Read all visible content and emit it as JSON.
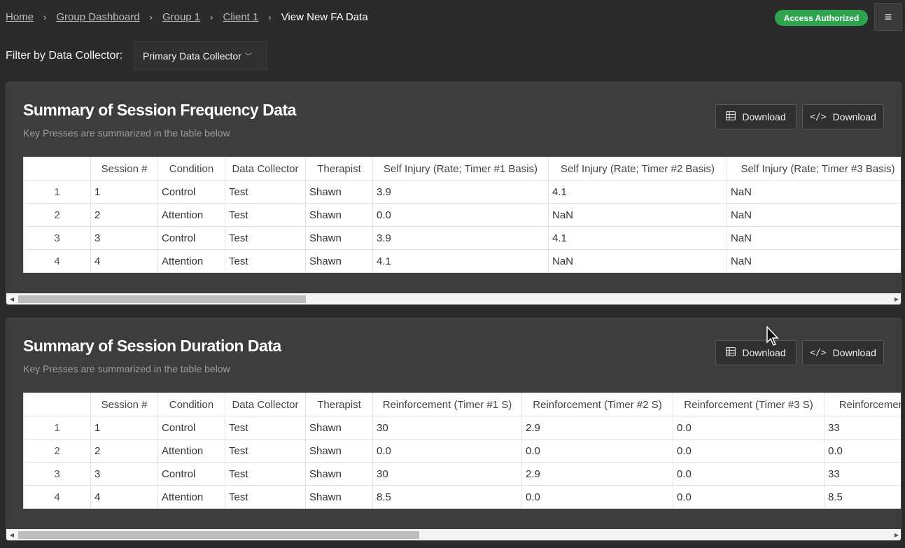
{
  "breadcrumb": {
    "items": [
      "Home",
      "Group Dashboard",
      "Group 1",
      "Client 1"
    ],
    "current": "View New FA Data"
  },
  "status_badge": "Access Authorized",
  "filter": {
    "label": "Filter by Data Collector:",
    "selected": "Primary Data Collector"
  },
  "frequency_panel": {
    "title": "Summary of Session Frequency Data",
    "subtitle": "Key Presses are summarized in the table below",
    "download_table_label": "Download",
    "download_code_label": "Download",
    "columns": [
      "",
      "Session #",
      "Condition",
      "Data Collector",
      "Therapist",
      "Self Injury (Rate; Timer #1 Basis)",
      "Self Injury (Rate; Timer #2 Basis)",
      "Self Injury (Rate; Timer #3 Basis)"
    ],
    "rows": [
      [
        "1",
        "1",
        "Control",
        "Test",
        "Shawn",
        "3.9",
        "4.1",
        "NaN"
      ],
      [
        "2",
        "2",
        "Attention",
        "Test",
        "Shawn",
        "0.0",
        "NaN",
        "NaN"
      ],
      [
        "3",
        "3",
        "Control",
        "Test",
        "Shawn",
        "3.9",
        "4.1",
        "NaN"
      ],
      [
        "4",
        "4",
        "Attention",
        "Test",
        "Shawn",
        "4.1",
        "NaN",
        "NaN"
      ]
    ],
    "scroll_fraction": 0.33
  },
  "duration_panel": {
    "title": "Summary of Session Duration Data",
    "subtitle": "Key Presses are summarized in the table below",
    "download_table_label": "Download",
    "download_code_label": "Download",
    "columns": [
      "",
      "Session #",
      "Condition",
      "Data Collector",
      "Therapist",
      "Reinforcement (Timer #1 S)",
      "Reinforcement (Timer #2 S)",
      "Reinforcement (Timer #3 S)",
      "Reinforcement"
    ],
    "rows": [
      [
        "1",
        "1",
        "Control",
        "Test",
        "Shawn",
        "30",
        "2.9",
        "0.0",
        "33"
      ],
      [
        "2",
        "2",
        "Attention",
        "Test",
        "Shawn",
        "0.0",
        "0.0",
        "0.0",
        "0.0"
      ],
      [
        "3",
        "3",
        "Control",
        "Test",
        "Shawn",
        "30",
        "2.9",
        "0.0",
        "33"
      ],
      [
        "4",
        "4",
        "Attention",
        "Test",
        "Shawn",
        "8.5",
        "0.0",
        "0.0",
        "8.5"
      ]
    ],
    "scroll_fraction": 0.46
  },
  "icons": {
    "menu": "hamburger-icon",
    "dropdown": "chevron-down-icon",
    "table_download": "table-grid-icon",
    "code_download": "code-icon",
    "scroll_left": "arrow-left-icon",
    "scroll_right": "arrow-right-icon",
    "cursor": "mouse-pointer-icon"
  }
}
